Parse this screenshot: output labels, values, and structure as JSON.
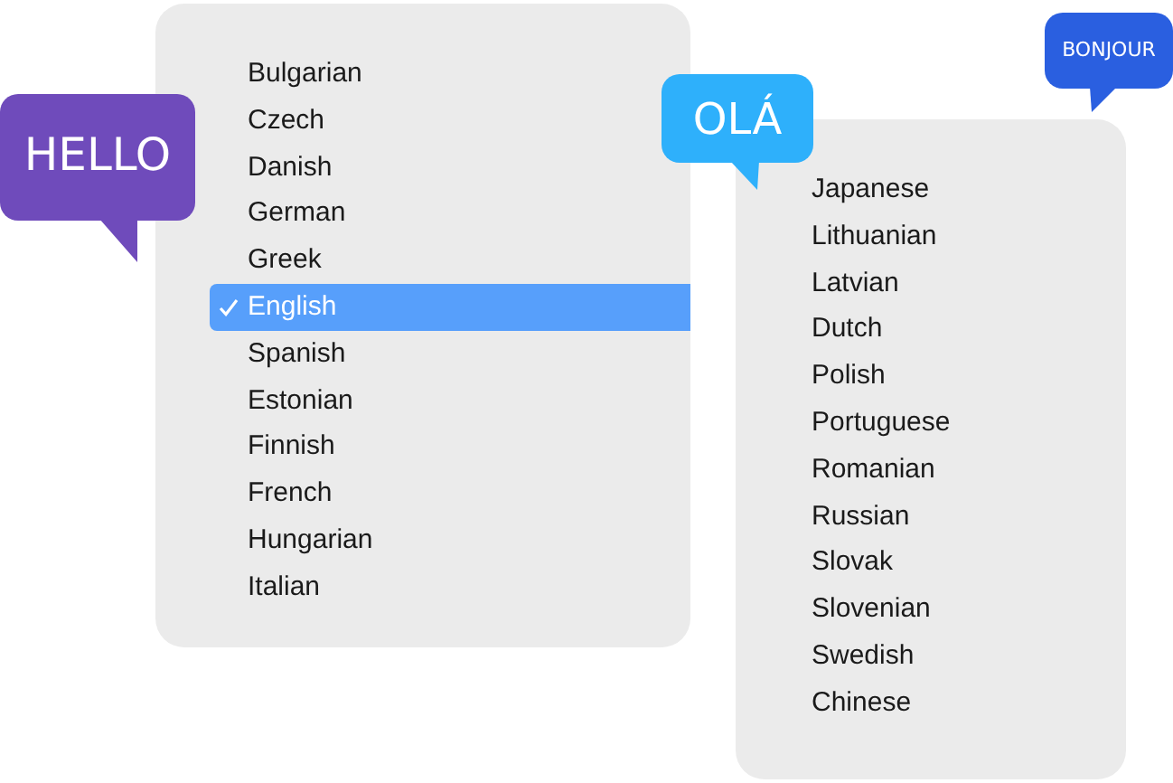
{
  "menus": [
    {
      "items": [
        {
          "label": "Bulgarian",
          "selected": false
        },
        {
          "label": "Czech",
          "selected": false
        },
        {
          "label": "Danish",
          "selected": false
        },
        {
          "label": "German",
          "selected": false
        },
        {
          "label": "Greek",
          "selected": false
        },
        {
          "label": "English",
          "selected": true
        },
        {
          "label": "Spanish",
          "selected": false
        },
        {
          "label": "Estonian",
          "selected": false
        },
        {
          "label": "Finnish",
          "selected": false
        },
        {
          "label": "French",
          "selected": false
        },
        {
          "label": "Hungarian",
          "selected": false
        },
        {
          "label": "Italian",
          "selected": false
        }
      ]
    },
    {
      "items": [
        {
          "label": "Japanese",
          "selected": false
        },
        {
          "label": "Lithuanian",
          "selected": false
        },
        {
          "label": "Latvian",
          "selected": false
        },
        {
          "label": "Dutch",
          "selected": false
        },
        {
          "label": "Polish",
          "selected": false
        },
        {
          "label": "Portuguese",
          "selected": false
        },
        {
          "label": "Romanian",
          "selected": false
        },
        {
          "label": "Russian",
          "selected": false
        },
        {
          "label": "Slovak",
          "selected": false
        },
        {
          "label": "Slovenian",
          "selected": false
        },
        {
          "label": "Swedish",
          "selected": false
        },
        {
          "label": "Chinese",
          "selected": false
        }
      ]
    }
  ],
  "bubbles": [
    {
      "text": "HELLO",
      "color": "#6f4bbb"
    },
    {
      "text": "OLÁ",
      "color": "#2eb0fb"
    },
    {
      "text": "BONJOUR",
      "color": "#2a5fe0"
    }
  ]
}
